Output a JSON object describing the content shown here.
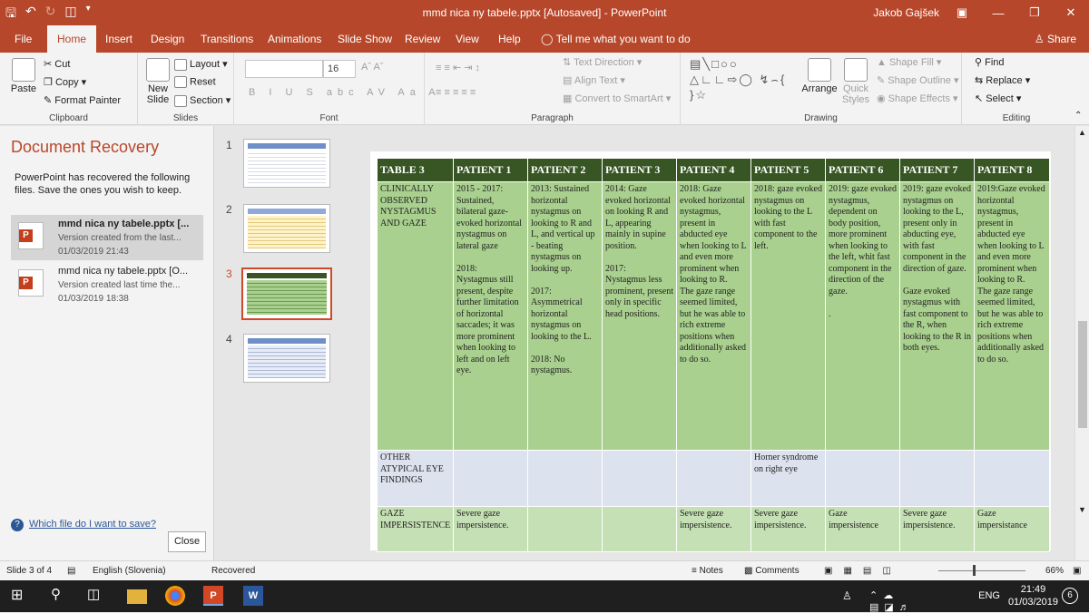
{
  "titlebar": {
    "title": "mmd nica ny tabele.pptx [Autosaved]  -  PowerPoint",
    "user": "Jakob Gajšek",
    "icons": [
      "save-icon",
      "undo-icon",
      "redo-icon",
      "present-icon"
    ]
  },
  "tabs": [
    {
      "label": "File"
    },
    {
      "label": "Home"
    },
    {
      "label": "Insert"
    },
    {
      "label": "Design"
    },
    {
      "label": "Transitions"
    },
    {
      "label": "Animations"
    },
    {
      "label": "Slide Show"
    },
    {
      "label": "Review"
    },
    {
      "label": "View"
    },
    {
      "label": "Help"
    }
  ],
  "tell_me": "Tell me what you want to do",
  "share": "Share",
  "ribbon": {
    "clipboard": {
      "paste": "Paste",
      "cut": "Cut",
      "copy": "Copy",
      "format_painter": "Format Painter",
      "label": "Clipboard"
    },
    "slides": {
      "new_slide": "New Slide",
      "layout": "Layout",
      "reset": "Reset",
      "section": "Section",
      "label": "Slides"
    },
    "font": {
      "size": "16",
      "label": "Font"
    },
    "paragraph": {
      "text_direction": "Text Direction",
      "align_text": "Align Text",
      "convert": "Convert to SmartArt",
      "label": "Paragraph"
    },
    "drawing": {
      "arrange": "Arrange",
      "quick_styles": "Quick Styles",
      "shape_fill": "Shape Fill",
      "shape_outline": "Shape Outline",
      "shape_effects": "Shape Effects",
      "label": "Drawing"
    },
    "editing": {
      "find": "Find",
      "replace": "Replace",
      "select": "Select",
      "label": "Editing"
    }
  },
  "recovery": {
    "title": "Document Recovery",
    "description": "PowerPoint has recovered the following files.  Save the ones you wish to keep.",
    "items": [
      {
        "name": "mmd nica ny tabele.pptx  [...",
        "version": "Version created from the last...",
        "time": "01/03/2019 21:43"
      },
      {
        "name": "mmd nica ny tabele.pptx  [O...",
        "version": "Version created last time the...",
        "time": "01/03/2019 18:38"
      }
    ],
    "help_link": "Which file do I want to save?",
    "close": "Close"
  },
  "thumbnails": [
    "1",
    "2",
    "3",
    "4"
  ],
  "table": {
    "header": [
      "TABLE 3",
      "PATIENT 1",
      "PATIENT 2",
      "PATIENT 3",
      "PATIENT 4",
      "PATIENT 5",
      "PATIENT 6",
      "PATIENT 7",
      "PATIENT 8"
    ],
    "rows": [
      [
        "CLINICALLY OBSERVED NYSTAGMUS AND GAZE",
        "2015 - 2017: Sustained, bilateral gaze-evoked horizontal nystagmus on lateral gaze\n\n2018:\nNystagmus still present, despite further limitation of horizontal saccades; it was more prominent when looking to left and on left eye.",
        "2013: Sustained horizontal nystagmus on looking to R and L, and vertical up - beating nystagmus on looking up.\n\n2017:\nAsymmetrical horizontal nystagmus on looking to the L.\n\n2018: No nystagmus.",
        "2014: Gaze evoked horizontal on looking R and L, appearing mainly in supine position.\n\n2017:\nNystagmus less prominent, present only in specific head positions.",
        "2018:  Gaze evoked horizontal nystagmus, present in abducted eye when looking to L and even more prominent when looking to R.\nThe gaze range seemed limited, but he was able to rich extreme positions when additionally asked to do so.",
        "2018: gaze evoked nystagmus on looking to the L with fast component to the left.",
        "2019: gaze evoked nystagmus, dependent on body position, more prominent when looking to the left, whit fast component in the direction of the gaze.\n\n.",
        "2019: gaze evoked nystagmus on looking to the L, present only in abducting eye, with fast component in the direction of gaze.\n\nGaze evoked nystagmus with fast component to the R, when looking to the R in both eyes.",
        "2019:Gaze evoked horizontal nystagmus, present in abducted eye when looking to L and even more prominent when looking to R.\nThe gaze range seemed limited, but he was able to rich extreme positions when additionally asked to do so."
      ],
      [
        "OTHER ATYPICAL EYE FINDINGS",
        "",
        "",
        "",
        "",
        "Horner syndrome on right eye",
        "",
        "",
        ""
      ],
      [
        "GAZE IMPERSISTENCE",
        "Severe gaze impersistence.",
        "",
        "",
        "Severe gaze impersistence.",
        "Severe gaze impersistence.",
        "Gaze impersistence",
        "Severe gaze impersistence.",
        "Gaze impersistance"
      ]
    ]
  },
  "status": {
    "slide": "Slide 3 of 4",
    "language": "English (Slovenia)",
    "state": "Recovered",
    "notes": "Notes",
    "comments": "Comments",
    "zoom": "66%"
  },
  "taskbar": {
    "time": "21:49",
    "date": "01/03/2019",
    "lang": "ENG",
    "notifications": "6"
  }
}
